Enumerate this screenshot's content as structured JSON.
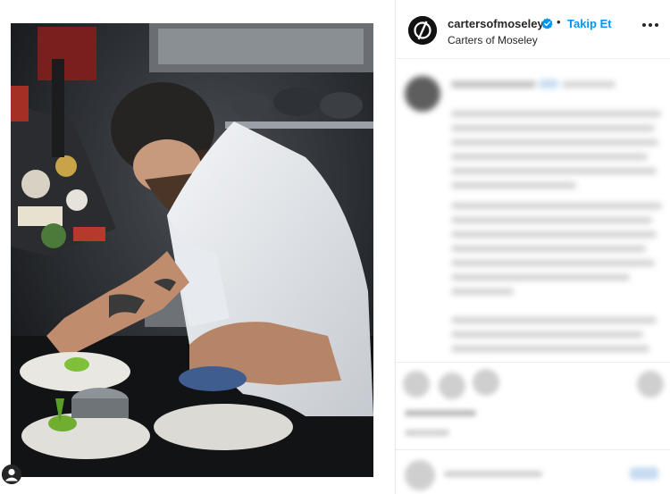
{
  "post": {
    "username": "cartersofmoseley",
    "separator": "•",
    "follow_label": "Takip Et",
    "display_name": "Carters of Moseley"
  },
  "icons": {
    "verified": "verified-badge-icon",
    "more": "more-options-icon",
    "profile": "profile-avatar-icon",
    "brand_logo": "slashed-circle-logo-icon"
  },
  "colors": {
    "accent": "#0095f6",
    "text": "#262626"
  }
}
